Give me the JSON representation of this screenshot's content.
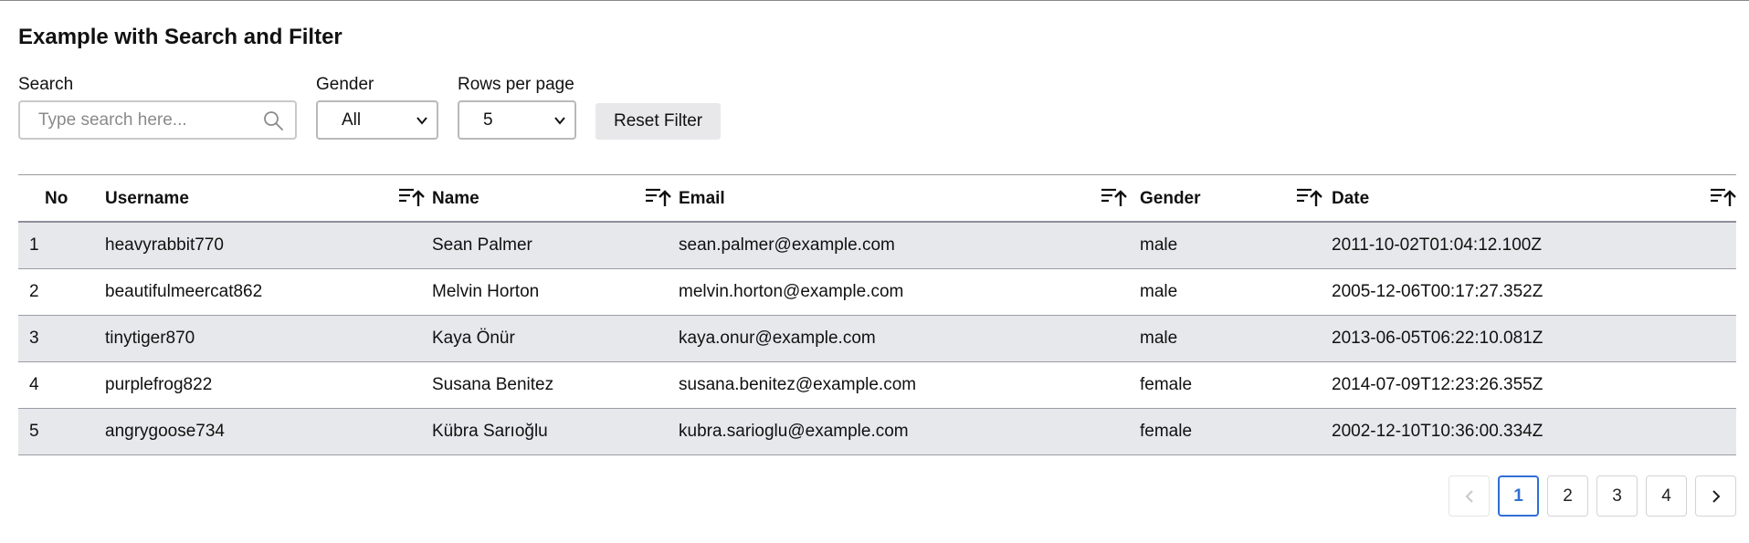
{
  "page": {
    "title": "Example with Search and Filter"
  },
  "filters": {
    "search_label": "Search",
    "search_placeholder": "Type search here...",
    "search_value": "",
    "gender_label": "Gender",
    "gender_selected": "All",
    "rows_label": "Rows per page",
    "rows_selected": "5",
    "reset_label": "Reset Filter"
  },
  "table": {
    "columns": [
      "No",
      "Username",
      "Name",
      "Email",
      "Gender",
      "Date"
    ],
    "rows": [
      {
        "no": "1",
        "username": "heavyrabbit770",
        "name": "Sean Palmer",
        "email": "sean.palmer@example.com",
        "gender": "male",
        "date": "2011-10-02T01:04:12.100Z"
      },
      {
        "no": "2",
        "username": "beautifulmeercat862",
        "name": "Melvin Horton",
        "email": "melvin.horton@example.com",
        "gender": "male",
        "date": "2005-12-06T00:17:27.352Z"
      },
      {
        "no": "3",
        "username": "tinytiger870",
        "name": "Kaya Önür",
        "email": "kaya.onur@example.com",
        "gender": "male",
        "date": "2013-06-05T06:22:10.081Z"
      },
      {
        "no": "4",
        "username": "purplefrog822",
        "name": "Susana Benitez",
        "email": "susana.benitez@example.com",
        "gender": "female",
        "date": "2014-07-09T12:23:26.355Z"
      },
      {
        "no": "5",
        "username": "angrygoose734",
        "name": "Kübra Sarıoğlu",
        "email": "kubra.sarioglu@example.com",
        "gender": "female",
        "date": "2002-12-10T10:36:00.334Z"
      }
    ]
  },
  "pagination": {
    "prev_icon": "chevron-left-icon",
    "next_icon": "chevron-right-icon",
    "pages": [
      "1",
      "2",
      "3",
      "4"
    ],
    "current": "1"
  },
  "colors": {
    "accent": "#2f6fd6",
    "row_stripe": "#e7e8eb"
  }
}
